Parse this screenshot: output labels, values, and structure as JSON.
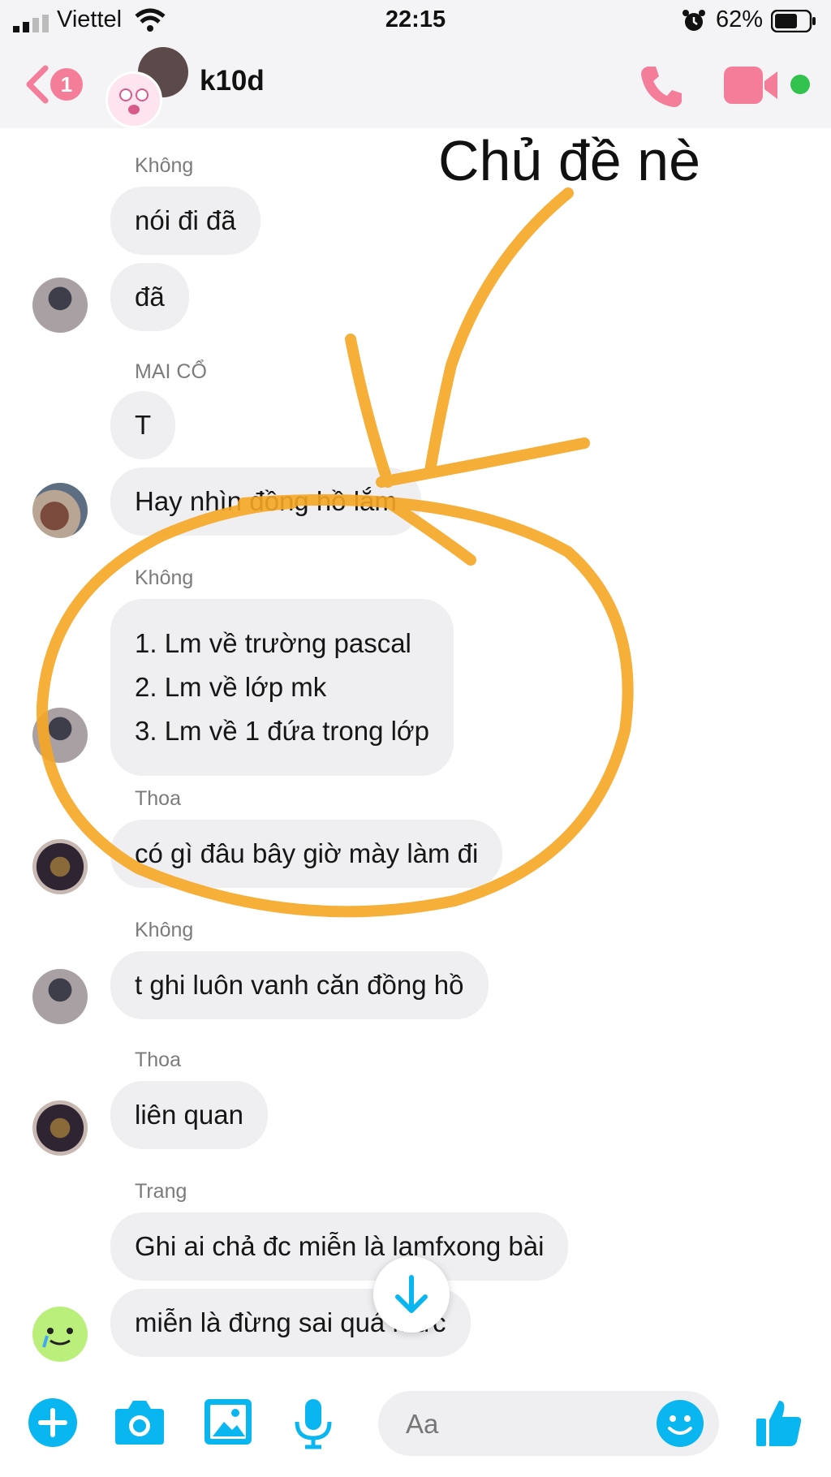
{
  "status_bar": {
    "carrier": "Viettel",
    "time": "22:15",
    "battery_percent": "62%"
  },
  "header": {
    "back_badge": "1",
    "chat_title": "k10d"
  },
  "annotation": {
    "text": "Chủ đề nè",
    "color": "#f5a623"
  },
  "messages": [
    {
      "sender": "Không",
      "bubbles": [
        "nói đi đã",
        "đã"
      ]
    },
    {
      "sender": "MAI CỔ",
      "bubbles": [
        "T",
        "Hay nhìn đồng hồ lắm"
      ]
    },
    {
      "sender": "Không",
      "lines": [
        "1. Lm về trường pascal",
        "2. Lm về lớp mk",
        "3. Lm về 1 đứa trong lớp"
      ]
    },
    {
      "sender": "Thoa",
      "bubbles": [
        "có gì đâu bây giờ mày làm đi"
      ]
    },
    {
      "sender": "Không",
      "bubbles": [
        "t ghi luôn vanh căn đồng hồ"
      ]
    },
    {
      "sender": "Thoa",
      "bubbles": [
        "liên quan"
      ]
    },
    {
      "sender": "Trang",
      "bubbles": [
        "Ghi ai chả đc miễn là lamfxong bài",
        "miễn là đừng sai quá mức"
      ]
    }
  ],
  "composer": {
    "placeholder": "Aa"
  },
  "colors": {
    "accent_blue": "#0ab6f0",
    "messenger_pink": "#f47d99",
    "online_green": "#32c24d"
  }
}
